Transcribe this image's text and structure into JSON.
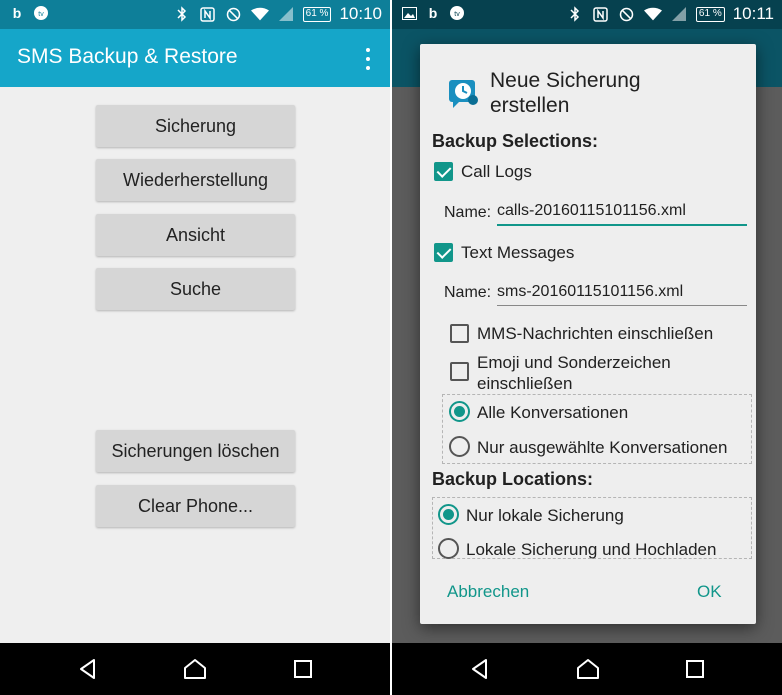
{
  "colors": {
    "accent": "#11968a",
    "appbar": "#15a6c9",
    "statusbar": "#0e7f99"
  },
  "left_screen": {
    "status": {
      "battery": "61 %",
      "time": "10:10"
    },
    "app_title": "SMS Backup & Restore",
    "buttons": [
      "Sicherung",
      "Wiederherstellung",
      "Ansicht",
      "Suche",
      "Sicherungen löschen",
      "Clear Phone..."
    ]
  },
  "right_screen": {
    "status": {
      "battery": "61 %",
      "time": "10:11"
    },
    "dialog": {
      "title": "Neue Sicherung erstellen",
      "backup_selections": "Backup Selections:",
      "call_logs": {
        "label": "Call Logs",
        "checked": true,
        "name_label": "Name:",
        "name_value": "calls-20160115101156.xml"
      },
      "text_messages": {
        "label": "Text Messages",
        "checked": true,
        "name_label": "Name:",
        "name_value": "sms-20160115101156.xml"
      },
      "mms": {
        "label": "MMS-Nachrichten einschließen",
        "checked": false
      },
      "emoji": {
        "label_line1": "Emoji und Sonderzeichen",
        "label_line2": "einschließen",
        "checked": false
      },
      "conversations": {
        "all": "Alle Konversationen",
        "selected": "Nur ausgewählte Konversationen"
      },
      "backup_locations": "Backup Locations:",
      "locations": {
        "local": "Nur lokale Sicherung",
        "upload": "Lokale Sicherung und Hochladen"
      },
      "cancel": "Abbrechen",
      "ok": "OK"
    }
  },
  "icons": [
    "image-icon",
    "app-b-icon",
    "tv-icon",
    "bluetooth-icon",
    "nfc-icon",
    "do-not-disturb-icon",
    "wifi-icon",
    "signal-icon",
    "battery-icon",
    "overflow-menu-icon",
    "backup-clock-icon",
    "back-icon",
    "home-icon",
    "recents-icon"
  ]
}
